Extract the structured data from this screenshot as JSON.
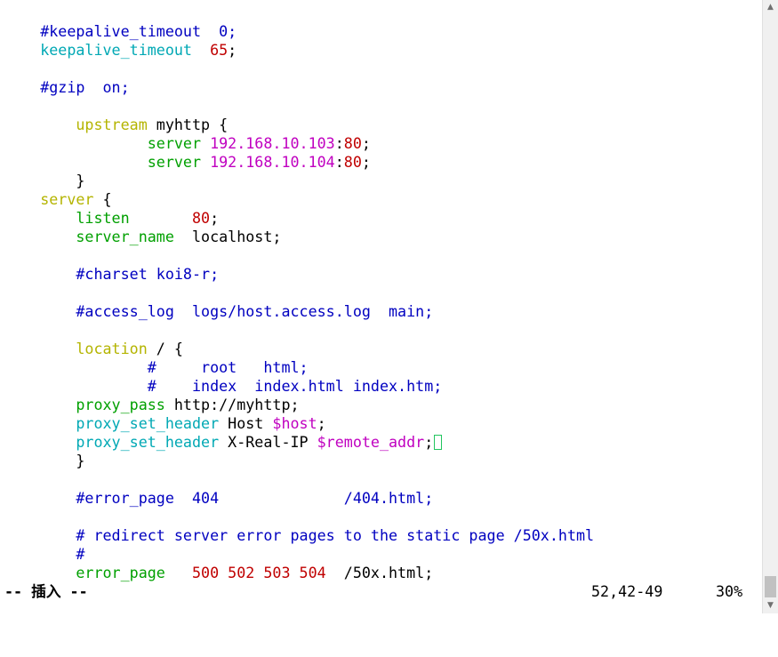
{
  "editor": {
    "lines": [
      [
        {
          "text": "    "
        },
        {
          "text": "#keepalive_timeout  0;",
          "color": "#0000c0"
        }
      ],
      [
        {
          "text": "    "
        },
        {
          "text": "keepalive_timeout",
          "color": "#00a8b4"
        },
        {
          "text": "  "
        },
        {
          "text": "65",
          "color": "#c00000"
        },
        {
          "text": ";",
          "color": "#000000"
        }
      ],
      [
        {
          "text": ""
        }
      ],
      [
        {
          "text": "    "
        },
        {
          "text": "#gzip  on;",
          "color": "#0000c0"
        }
      ],
      [
        {
          "text": ""
        }
      ],
      [
        {
          "text": "        "
        },
        {
          "text": "upstream",
          "color": "#b4b400"
        },
        {
          "text": " myhttp {",
          "color": "#000000"
        }
      ],
      [
        {
          "text": "                "
        },
        {
          "text": "server",
          "color": "#00a000"
        },
        {
          "text": " "
        },
        {
          "text": "192.168.10.103",
          "color": "#c000c0"
        },
        {
          "text": ":",
          "color": "#000000"
        },
        {
          "text": "80",
          "color": "#c00000"
        },
        {
          "text": ";",
          "color": "#000000"
        }
      ],
      [
        {
          "text": "                "
        },
        {
          "text": "server",
          "color": "#00a000"
        },
        {
          "text": " "
        },
        {
          "text": "192.168.10.104",
          "color": "#c000c0"
        },
        {
          "text": ":",
          "color": "#000000"
        },
        {
          "text": "80",
          "color": "#c00000"
        },
        {
          "text": ";",
          "color": "#000000"
        }
      ],
      [
        {
          "text": "        "
        },
        {
          "text": "}",
          "color": "#000000"
        }
      ],
      [
        {
          "text": "    "
        },
        {
          "text": "server",
          "color": "#b4b400"
        },
        {
          "text": " {",
          "color": "#000000"
        }
      ],
      [
        {
          "text": "        "
        },
        {
          "text": "listen",
          "color": "#00a000"
        },
        {
          "text": "       "
        },
        {
          "text": "80",
          "color": "#c00000"
        },
        {
          "text": ";",
          "color": "#000000"
        }
      ],
      [
        {
          "text": "        "
        },
        {
          "text": "server_name",
          "color": "#00a000"
        },
        {
          "text": "  localhost;",
          "color": "#000000"
        }
      ],
      [
        {
          "text": ""
        }
      ],
      [
        {
          "text": "        "
        },
        {
          "text": "#charset koi8-r;",
          "color": "#0000c0"
        }
      ],
      [
        {
          "text": ""
        }
      ],
      [
        {
          "text": "        "
        },
        {
          "text": "#access_log  logs/host.access.log  main;",
          "color": "#0000c0"
        }
      ],
      [
        {
          "text": ""
        }
      ],
      [
        {
          "text": "        "
        },
        {
          "text": "location",
          "color": "#b4b400"
        },
        {
          "text": " / {",
          "color": "#000000"
        }
      ],
      [
        {
          "text": "                "
        },
        {
          "text": "#     root   html;",
          "color": "#0000c0"
        }
      ],
      [
        {
          "text": "                "
        },
        {
          "text": "#    index  index.html index.htm;",
          "color": "#0000c0"
        }
      ],
      [
        {
          "text": "        "
        },
        {
          "text": "proxy_pass",
          "color": "#00a000"
        },
        {
          "text": " http://myhttp;",
          "color": "#000000"
        }
      ],
      [
        {
          "text": "        "
        },
        {
          "text": "proxy_set_header",
          "color": "#00a8b4"
        },
        {
          "text": " Host ",
          "color": "#000000"
        },
        {
          "text": "$host",
          "color": "#c000c0"
        },
        {
          "text": ";",
          "color": "#000000"
        }
      ],
      [
        {
          "text": "        "
        },
        {
          "text": "proxy_set_header",
          "color": "#00a8b4"
        },
        {
          "text": " X-Real-IP ",
          "color": "#000000"
        },
        {
          "text": "$remote_addr",
          "color": "#c000c0"
        },
        {
          "text": ";",
          "color": "#000000"
        }
      ],
      [
        {
          "text": "        "
        },
        {
          "text": "}",
          "color": "#000000"
        }
      ],
      [
        {
          "text": ""
        }
      ],
      [
        {
          "text": "        "
        },
        {
          "text": "#error_page  404              /404.html;",
          "color": "#0000c0"
        }
      ],
      [
        {
          "text": ""
        }
      ],
      [
        {
          "text": "        "
        },
        {
          "text": "# redirect server error pages to the static page /50x.html",
          "color": "#0000c0"
        }
      ],
      [
        {
          "text": "        "
        },
        {
          "text": "#",
          "color": "#0000c0"
        }
      ],
      [
        {
          "text": "        "
        },
        {
          "text": "error_page",
          "color": "#00a000"
        },
        {
          "text": "   "
        },
        {
          "text": "500 502 503 504",
          "color": "#c00000"
        },
        {
          "text": "  /50x.html;",
          "color": "#000000"
        }
      ]
    ],
    "cursor_line_index": 22
  },
  "status": {
    "mode": "-- 插入 --",
    "position": "52,42-49",
    "percent": "30%"
  },
  "scrollbar": {
    "up_arrow": "▲",
    "down_arrow": "▼",
    "position_fraction": 0.3
  },
  "colors": {
    "comment": "#0000c0",
    "keyword": "#b4b400",
    "directive": "#00a000",
    "header_directive": "#00a8b4",
    "number": "#c00000",
    "address": "#c000c0",
    "cursor_border": "#22c55e"
  }
}
